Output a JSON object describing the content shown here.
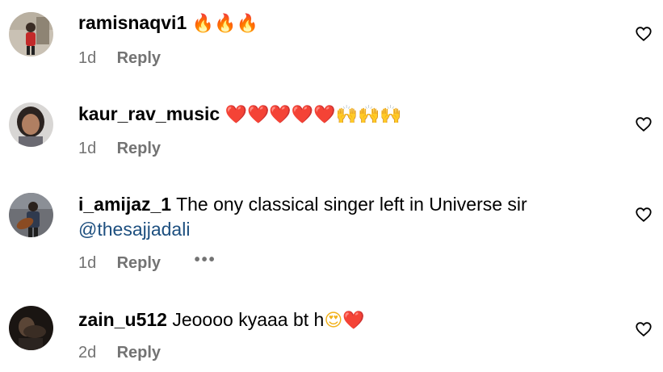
{
  "comments": [
    {
      "username": "ramisnaqvi1",
      "text": "",
      "emoji": [
        "🔥",
        "🔥",
        "🔥"
      ],
      "emoji_names": [
        "fire-emoji",
        "fire-emoji",
        "fire-emoji"
      ],
      "time": "1d",
      "reply": "Reply"
    },
    {
      "username": "kaur_rav_music",
      "text": "",
      "emoji": [
        "❤️",
        "❤️",
        "❤️",
        "❤️",
        "❤️",
        "🙌",
        "🙌",
        "🙌"
      ],
      "emoji_names": [
        "red-heart-emoji",
        "red-heart-emoji",
        "red-heart-emoji",
        "red-heart-emoji",
        "red-heart-emoji",
        "raising-hands-emoji",
        "raising-hands-emoji",
        "raising-hands-emoji"
      ],
      "time": "1d",
      "reply": "Reply"
    },
    {
      "username": "i_amijaz_1",
      "text": "The ony classical singer left in Universe sir",
      "mention": "@thesajjadali",
      "time": "1d",
      "reply": "Reply",
      "more": "•••"
    },
    {
      "username": "zain_u512",
      "text": "Jeoooo kyaaa bt h",
      "emoji": [
        "😍",
        "❤️"
      ],
      "emoji_names": [
        "heart-eyes-emoji",
        "red-heart-emoji"
      ],
      "time": "2d",
      "reply": "Reply"
    }
  ],
  "colors": {
    "secondary_text": "#737373",
    "mention": "#1d4f7f",
    "primary_text": "#000000"
  },
  "icons": {
    "like": "heart-outline-icon",
    "more": "more-options-icon"
  }
}
